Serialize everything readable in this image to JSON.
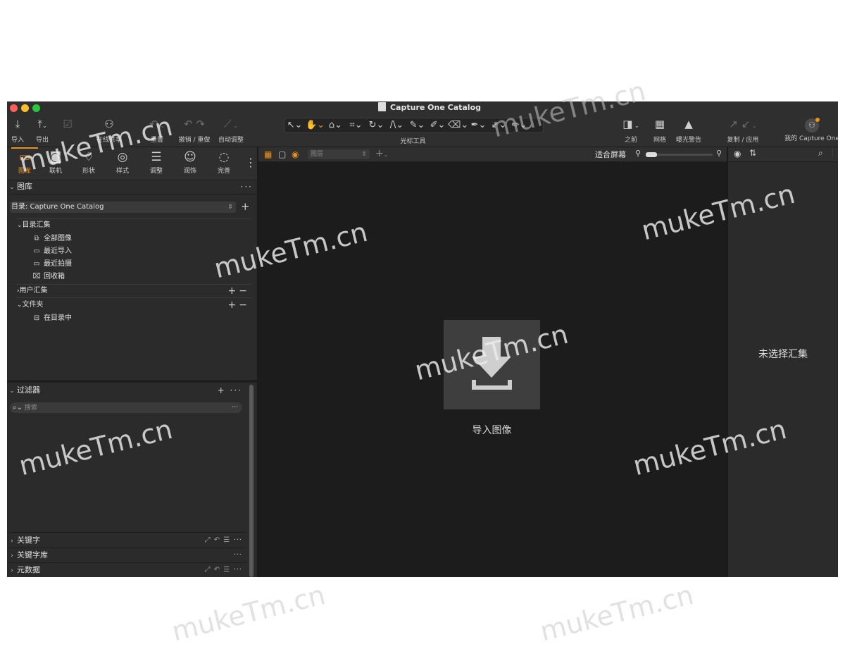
{
  "window": {
    "title": "Capture One Catalog"
  },
  "toolbar": {
    "import_label": "导入",
    "export_label": "导出",
    "share_label": "在线共享",
    "reset_label": "重置",
    "undo_redo_label": "撤销 / 重做",
    "auto_adjust_label": "自动调整",
    "cursor_tools_label": "光标工具",
    "before_label": "之前",
    "grid_label": "网格",
    "exposure_warning_label": "曝光警告",
    "copy_apply_label": "复制 / 应用",
    "my_capture_one_label": "我的 Capture One"
  },
  "tool_tabs": [
    {
      "label": "图库",
      "icon": "library-icon",
      "active": true
    },
    {
      "label": "联机",
      "icon": "camera-icon"
    },
    {
      "label": "形状",
      "icon": "shape-icon"
    },
    {
      "label": "样式",
      "icon": "style-icon"
    },
    {
      "label": "调整",
      "icon": "sliders-icon"
    },
    {
      "label": "润饰",
      "icon": "retouch-icon"
    },
    {
      "label": "完善",
      "icon": "refine-icon"
    }
  ],
  "library": {
    "title": "图库",
    "catalog_select": "目录: Capture One Catalog",
    "catalog_collections": "目录汇集",
    "items": [
      "全部图像",
      "最近导入",
      "最近拍摄",
      "回收箱"
    ],
    "user_collections": "用户汇集",
    "folders": "文件夹",
    "in_catalog": "在目录中"
  },
  "filters": {
    "title": "过滤器",
    "search_placeholder": "搜索"
  },
  "bottom_sections": [
    "关键字",
    "关键字库",
    "元数据"
  ],
  "viewer": {
    "layer_placeholder": "图层",
    "fit_label": "适合屏幕",
    "zoom_level": 0.1,
    "import_images_label": "导入图像"
  },
  "browser": {
    "no_collection_label": "未选择汇集"
  },
  "watermark": "mukeTm.cn",
  "colors": {
    "accent": "#f0930e",
    "background": "#2b2b2b",
    "viewer": "#1c1c1c"
  }
}
